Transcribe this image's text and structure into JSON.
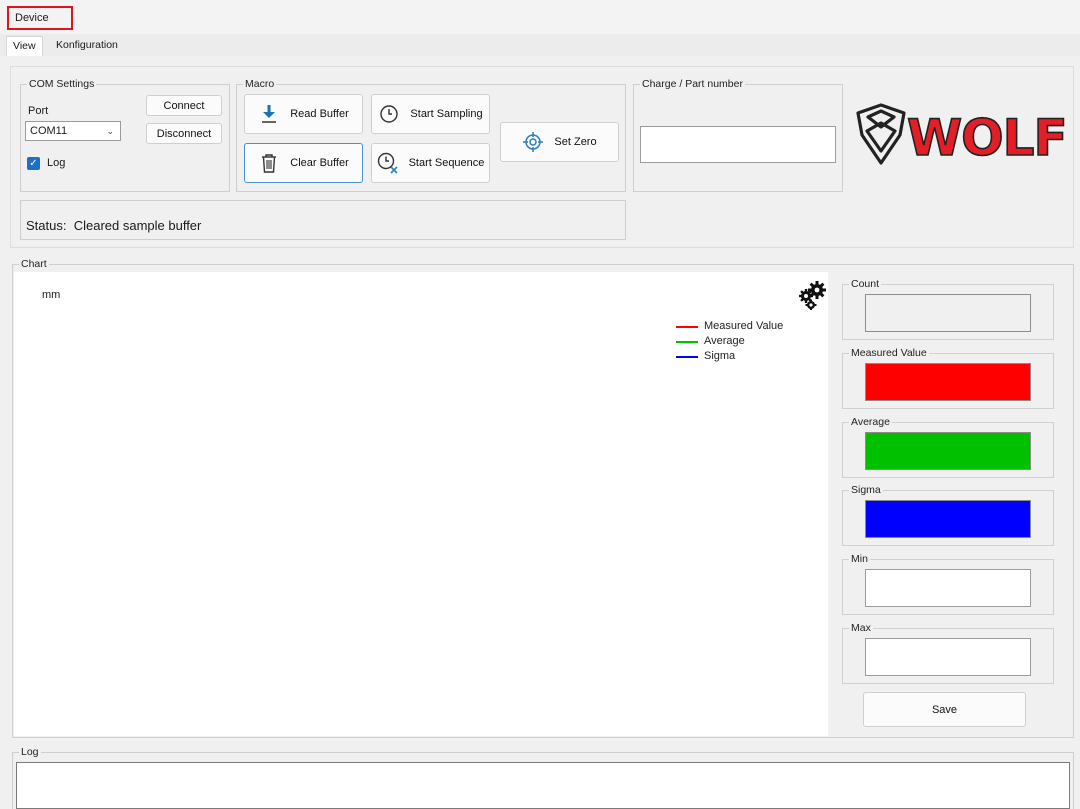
{
  "menu": {
    "device": "Device"
  },
  "tabs": [
    "View",
    "Konfiguration"
  ],
  "com_settings": {
    "title": "COM Settings",
    "port_label": "Port",
    "port_value": "COM11",
    "connect": "Connect",
    "disconnect": "Disconnect",
    "log_label": "Log",
    "log_checked": true
  },
  "macro": {
    "title": "Macro",
    "read_buffer": "Read Buffer",
    "start_sampling": "Start Sampling",
    "set_zero": "Set Zero",
    "clear_buffer": "Clear Buffer",
    "start_sequence": "Start Sequence"
  },
  "charge": {
    "title": "Charge / Part number",
    "value": ""
  },
  "logo": {
    "text": "WOLF",
    "color": "#e41e26"
  },
  "status": {
    "label": "Status:",
    "text": "Cleared sample buffer"
  },
  "chart": {
    "title": "Chart",
    "unit": "mm",
    "settings_icon": "gears-icon",
    "legend": [
      {
        "name": "Measured Value",
        "color": "#ff0000"
      },
      {
        "name": "Average",
        "color": "#00c000"
      },
      {
        "name": "Sigma",
        "color": "#0000ff"
      }
    ]
  },
  "stats": {
    "count": {
      "label": "Count",
      "value": ""
    },
    "measured": {
      "label": "Measured Value",
      "color": "#ff0000"
    },
    "average": {
      "label": "Average",
      "color": "#00c000"
    },
    "sigma": {
      "label": "Sigma",
      "color": "#0000ff"
    },
    "min": {
      "label": "Min",
      "value": ""
    },
    "max": {
      "label": "Max",
      "value": ""
    },
    "save": "Save"
  },
  "log": {
    "title": "Log",
    "content": ""
  }
}
